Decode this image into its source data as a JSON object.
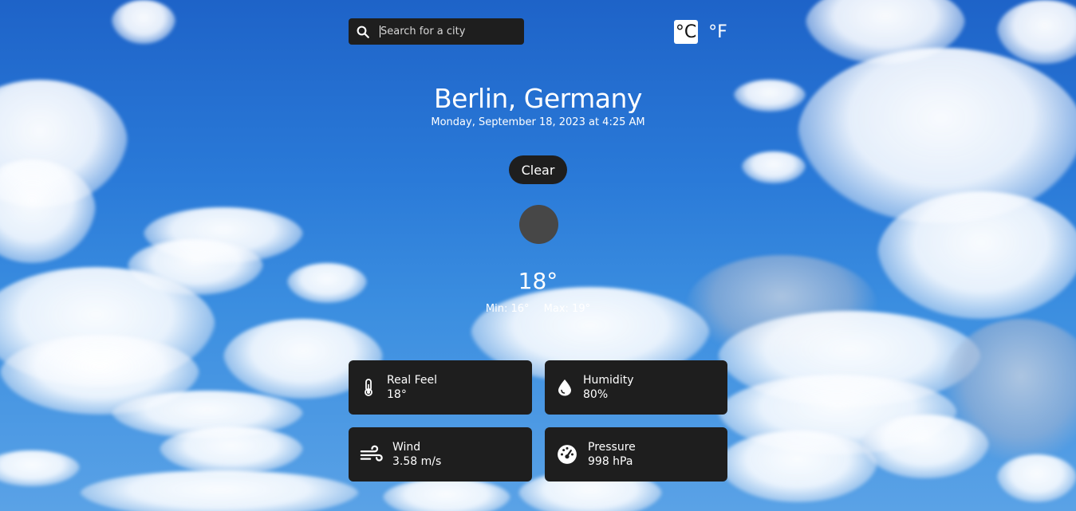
{
  "search": {
    "placeholder": "Search for a city",
    "value": ""
  },
  "units": {
    "celsius_label": "°C",
    "fahrenheit_label": "°F",
    "selected": "celsius"
  },
  "location": {
    "name": "Berlin, Germany",
    "datetime": "Monday, September 18, 2023 at 4:25 AM"
  },
  "current": {
    "condition": "Clear",
    "icon": "weather-condition-icon",
    "temperature": "18°",
    "min": "Min: 16°",
    "max": "Max: 19°"
  },
  "details": [
    {
      "label": "Real Feel",
      "value": "18°",
      "icon": "thermometer-icon"
    },
    {
      "label": "Humidity",
      "value": "80%",
      "icon": "water-drop-icon"
    },
    {
      "label": "Wind",
      "value": "3.58 m/s",
      "icon": "wind-icon"
    },
    {
      "label": "Pressure",
      "value": "998 hPa",
      "icon": "gauge-icon"
    }
  ],
  "colors": {
    "card_bg": "#1e1e1e",
    "text": "#ffffff",
    "sky": "#2a7ad8"
  }
}
